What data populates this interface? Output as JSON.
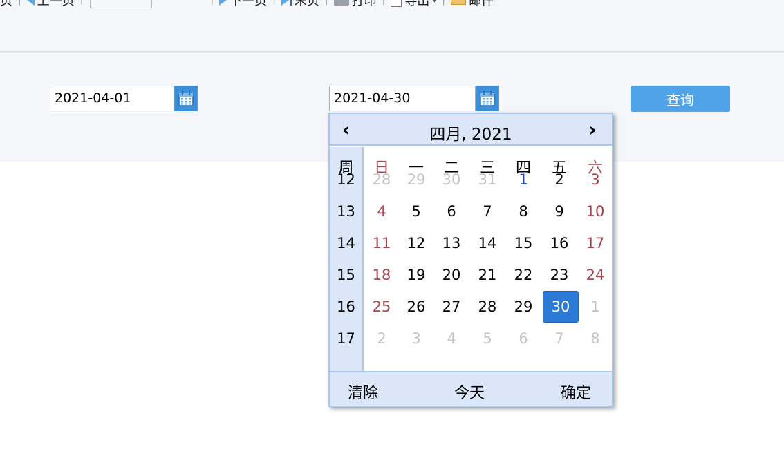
{
  "toolbar": {
    "first_page_tail": "页",
    "prev_label": "上一页",
    "next_label": "下一页",
    "last_label": "末页",
    "print_label": "打印",
    "export_label": "导出",
    "mail_label": "邮件"
  },
  "filters": {
    "start_date": "2021-04-01",
    "end_date": "2021-04-30",
    "query_label": "查询"
  },
  "calendar": {
    "prev_icon": "‹",
    "next_icon": "›",
    "title": "四月, 2021",
    "week_header": "周",
    "weekday_headers": [
      "日",
      "一",
      "二",
      "三",
      "四",
      "五",
      "六"
    ],
    "weeks": [
      {
        "week": "12",
        "days": [
          "28",
          "29",
          "30",
          "31",
          "1",
          "2",
          "3"
        ]
      },
      {
        "week": "13",
        "days": [
          "4",
          "5",
          "6",
          "7",
          "8",
          "9",
          "10"
        ]
      },
      {
        "week": "14",
        "days": [
          "11",
          "12",
          "13",
          "14",
          "15",
          "16",
          "17"
        ]
      },
      {
        "week": "15",
        "days": [
          "18",
          "19",
          "20",
          "21",
          "22",
          "23",
          "24"
        ]
      },
      {
        "week": "16",
        "days": [
          "25",
          "26",
          "27",
          "28",
          "29",
          "30",
          "1"
        ]
      },
      {
        "week": "17",
        "days": [
          "2",
          "3",
          "4",
          "5",
          "6",
          "7",
          "8"
        ]
      }
    ],
    "selected_day": "30",
    "today_day": "1",
    "clear_label": "清除",
    "today_label": "今天",
    "ok_label": "确定",
    "colors": {
      "weekend": "#a8434f",
      "today": "#1a3ee0",
      "selected_bg": "#2a79d6",
      "outside": "#c4c4c4",
      "header_bg": "#dbe7f8"
    }
  }
}
